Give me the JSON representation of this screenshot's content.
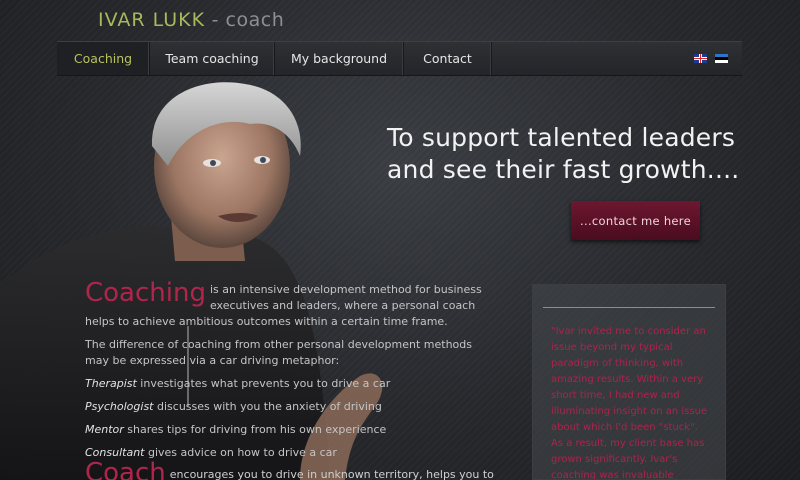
{
  "brand": {
    "name": "IVAR LUKK",
    "separator": " - ",
    "sub": "coach"
  },
  "nav": {
    "items": [
      {
        "label": "Coaching",
        "active": true
      },
      {
        "label": "Team coaching"
      },
      {
        "label": "My background"
      },
      {
        "label": "Contact"
      }
    ],
    "flags": [
      "uk-flag-icon",
      "estonia-flag-icon"
    ]
  },
  "hero": {
    "headline_line1": "To support talented leaders",
    "headline_line2": "and see their fast growth....",
    "cta_label": "...contact me here"
  },
  "content": {
    "title_word": "Coaching",
    "intro": "is an intensive development method for business executives and leaders, where a personal coach helps to achieve ambitious outcomes within a certain time frame.",
    "difference": "The difference of coaching from other personal development methods may be expressed via a car driving metaphor:",
    "roles": [
      {
        "role": "Therapist",
        "text": " investigates what prevents you to drive a car"
      },
      {
        "role": "Psychologist",
        "text": " discusses with you the anxiety of driving"
      },
      {
        "role": "Mentor",
        "text": " shares tips for driving from his own experience"
      },
      {
        "role": "Consultant",
        "text": " gives advice on how to drive a car"
      }
    ],
    "coach_word": "Coach",
    "coach_text": "encourages you to drive in unknown territory, helps you to navigate"
  },
  "quote": {
    "text": "\"Ivar invited me to consider an issue beyond my typical paradigm of thinking, with amazing results. Within a very short time, I had new and illuminating insight on an issue about which I'd been \"stuck\". As a result, my client base has grown significantly. Ivar's coaching was invaluable"
  },
  "colors": {
    "accent_green": "#b8c25f",
    "accent_red": "#b1254c",
    "cta_bg": "#5c1128"
  }
}
